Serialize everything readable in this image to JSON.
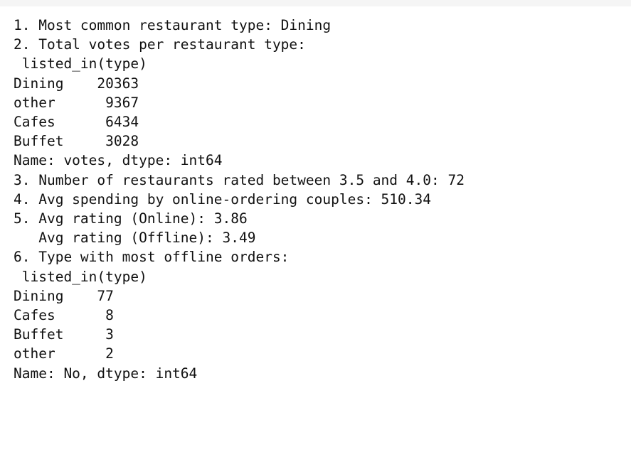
{
  "output": {
    "text": "1. Most common restaurant type: Dining\n2. Total votes per restaurant type:\n listed_in(type)\nDining    20363\nother      9367\nCafes      6434\nBuffet     3028\nName: votes, dtype: int64\n3. Number of restaurants rated between 3.5 and 4.0: 72\n4. Avg spending by online-ordering couples: 510.34\n5. Avg rating (Online): 3.86\n   Avg rating (Offline): 3.49\n6. Type with most offline orders:\n listed_in(type)\nDining    77\nCafes      8\nBuffet     3\nother      2\nName: No, dtype: int64"
  }
}
